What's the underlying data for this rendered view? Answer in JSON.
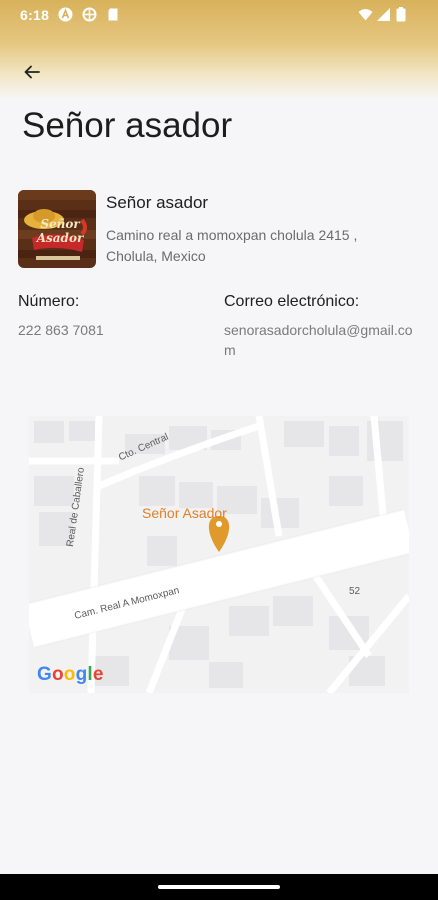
{
  "status_bar": {
    "time": "6:18"
  },
  "header": {
    "title": "Señor asador"
  },
  "business": {
    "name": "Señor asador",
    "address": "Camino real a momoxpan cholula 2415 , Cholula, Mexico",
    "logo_text_line1": "Señor",
    "logo_text_line2": "Asador"
  },
  "contact": {
    "phone_label": "Número:",
    "phone_value": "222 863 7081",
    "email_label": "Correo electrónico:",
    "email_value": "senorasadorcholula@gmail.com"
  },
  "map": {
    "place_label": "Señor Asador",
    "road_main": "Cam. Real A Momoxpan",
    "road_side": "Real de Caballero",
    "road_top": "Cto. Central",
    "number_label": "52",
    "google_logo": "Google",
    "pin_color": "#e09a2b"
  },
  "colors": {
    "accent": "#d8b15a",
    "place_label": "#e07f28"
  }
}
